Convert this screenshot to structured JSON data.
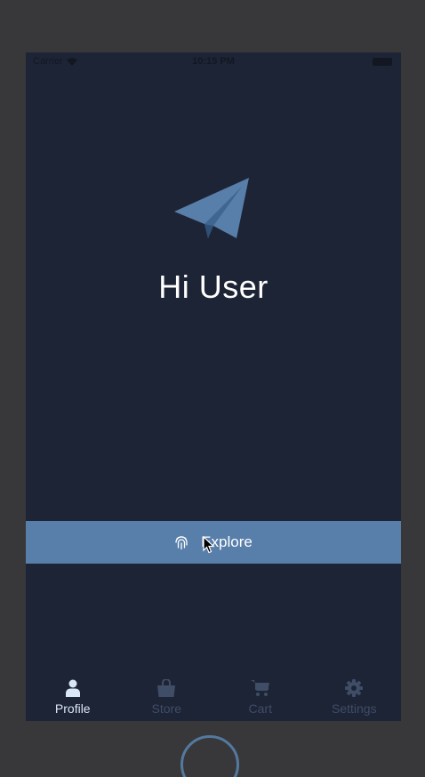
{
  "status_bar": {
    "carrier": "Carrier",
    "time": "10:15 PM"
  },
  "hero": {
    "logo_icon": "paper-plane-icon",
    "greeting": "Hi User"
  },
  "explore_button": {
    "icon": "fingerprint-icon",
    "label": "Explore"
  },
  "tab_bar": {
    "tabs": [
      {
        "label": "Profile",
        "icon": "person-icon",
        "active": true
      },
      {
        "label": "Store",
        "icon": "shopping-bag-icon",
        "active": false
      },
      {
        "label": "Cart",
        "icon": "cart-icon",
        "active": false
      },
      {
        "label": "Settings",
        "icon": "gear-icon",
        "active": false
      }
    ]
  },
  "colors": {
    "screen_background": "#1d2436",
    "accent": "#587eaa",
    "tab_active": "#d9e6f5",
    "tab_inactive": "#3f4d66",
    "device_frame": "#38383b"
  }
}
